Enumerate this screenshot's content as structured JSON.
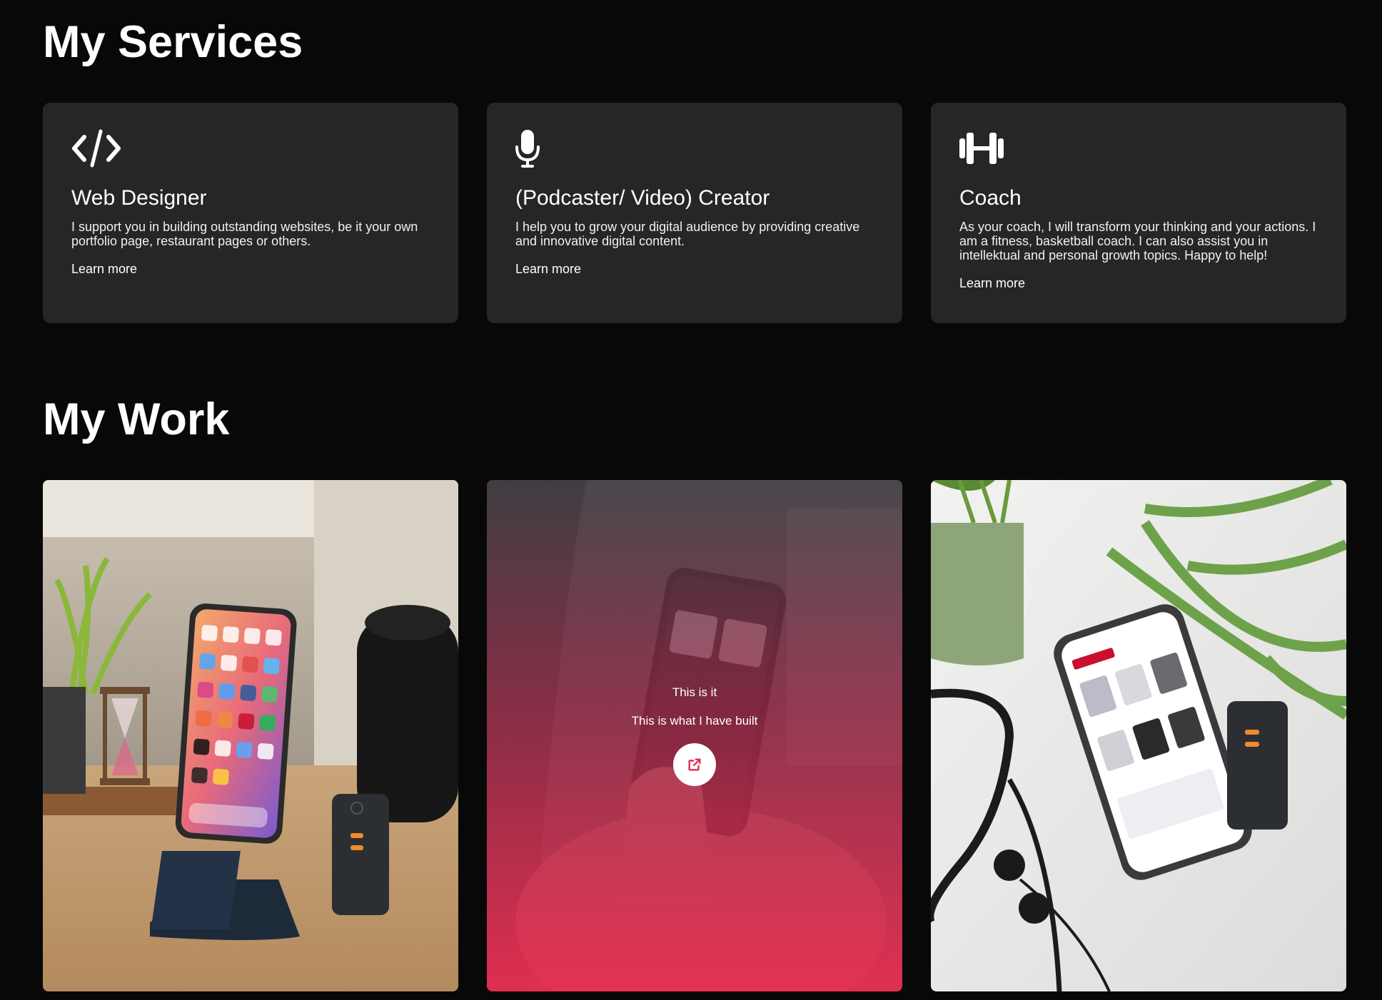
{
  "services": {
    "title": "My Services",
    "cards": [
      {
        "icon": "code-icon",
        "title": "Web Designer",
        "description": "I support you in building outstanding websites, be it your own portfolio page, restaurant pages or others.",
        "link": "Learn more"
      },
      {
        "icon": "microphone-icon",
        "title": "(Podcaster/ Video) Creator",
        "description": "I help you to grow your digital audience by providing creative and innovative digital content.",
        "link": "Learn more"
      },
      {
        "icon": "dumbbell-icon",
        "title": "Coach",
        "description": "As your coach, I will transform your thinking and your actions. I am a fitness, basketball coach. I can also assist you in intellektual and personal growth topics. Happy to help!",
        "link": "Learn more"
      }
    ]
  },
  "work": {
    "title": "My Work",
    "items": [
      {
        "image": "phone-on-stand-photo"
      },
      {
        "image": "phone-in-hand-photo",
        "overlay_title": "This is it",
        "overlay_subtitle": "This is what I have built",
        "button_icon": "external-link-icon"
      },
      {
        "image": "phone-store-app-photo"
      }
    ]
  },
  "colors": {
    "background": "#080808",
    "card": "#262626",
    "accent": "#e12d50",
    "text": "#ffffff"
  }
}
